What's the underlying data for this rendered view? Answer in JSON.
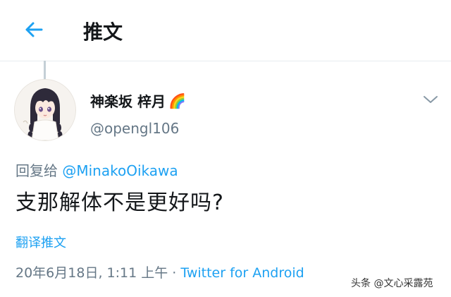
{
  "header": {
    "title": "推文"
  },
  "tweet": {
    "display_name": "神楽坂 梓月",
    "emoji": "🌈",
    "handle": "@opengl106",
    "reply_prefix": "回复给 ",
    "reply_to": "@MinakoOikawa",
    "text": "支那解体不是更好吗?",
    "translate_label": "翻译推文",
    "timestamp": "20年6月18日, 1:11 上午",
    "separator": " · ",
    "source": "Twitter for Android"
  },
  "watermark": "头条 @文心采露苑",
  "colors": {
    "accent": "#1da1f2",
    "secondary_text": "#657786",
    "primary_text": "#14171a"
  },
  "icons": {
    "back": "arrow-left-icon",
    "more": "chevron-down-icon"
  }
}
